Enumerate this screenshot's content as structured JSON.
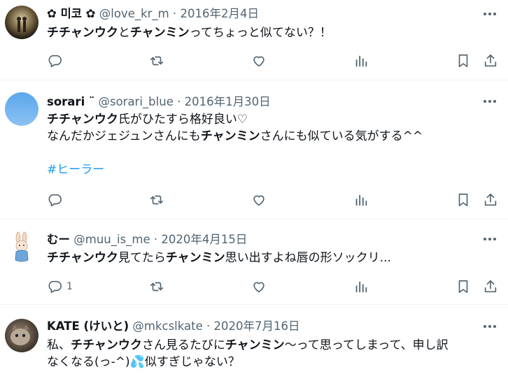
{
  "tweets": [
    {
      "name": "✿ 미코 ✿",
      "handle": "@love_kr_m",
      "sep": "·",
      "date": "2016年2月4日",
      "text_segments": [
        {
          "t": "チチャンウク",
          "b": true
        },
        {
          "t": "と",
          "b": false
        },
        {
          "t": "チャンミン",
          "b": true
        },
        {
          "t": "ってちょっと似てない？！",
          "b": false
        }
      ],
      "reply_count": ""
    },
    {
      "name": "sorari ¨",
      "handle": "@sorari_blue",
      "sep": "·",
      "date": "2016年1月30日",
      "line1": [
        {
          "t": "チチャンウク",
          "b": true
        },
        {
          "t": "氏がひたすら格好良い♡",
          "b": false
        }
      ],
      "line2": [
        {
          "t": "なんだかジェジュンさんにも",
          "b": false
        },
        {
          "t": "チャンミン",
          "b": true
        },
        {
          "t": "さんにも似ている気がする^^",
          "b": false
        }
      ],
      "hashtag": "#ヒーラー",
      "reply_count": ""
    },
    {
      "name": "むー",
      "handle": "@muu_is_me",
      "sep": "·",
      "date": "2020年4月15日",
      "text_segments": [
        {
          "t": "チチャンウク",
          "b": true
        },
        {
          "t": "見てたら",
          "b": false
        },
        {
          "t": "チャンミン",
          "b": true
        },
        {
          "t": "思い出すよね唇の形ソックリ...",
          "b": false
        }
      ],
      "reply_count": "1"
    },
    {
      "name": "KATE (けいと)",
      "handle": "@mkcslkate",
      "sep": "·",
      "date": "2020年7月16日",
      "line1": [
        {
          "t": "私、",
          "b": false
        },
        {
          "t": "チチャンウク",
          "b": true
        },
        {
          "t": "さん見るたびに",
          "b": false
        },
        {
          "t": "チャンミン",
          "b": true
        },
        {
          "t": "〜って思ってしまって、申し訳",
          "b": false
        }
      ],
      "line2": [
        {
          "t": "なくなる(っ-^)",
          "b": false
        },
        {
          "t": "💦",
          "b": false
        },
        {
          "t": "似すぎじゃない？",
          "b": false
        }
      ]
    }
  ],
  "icons": [
    "reply-icon",
    "retweet-icon",
    "like-icon",
    "views-icon",
    "bookmark-icon",
    "share-icon",
    "more-icon"
  ],
  "colors": {
    "text": "#0f1419",
    "meta": "#536471",
    "link": "#1d9bf0",
    "divider": "#eff3f4"
  }
}
